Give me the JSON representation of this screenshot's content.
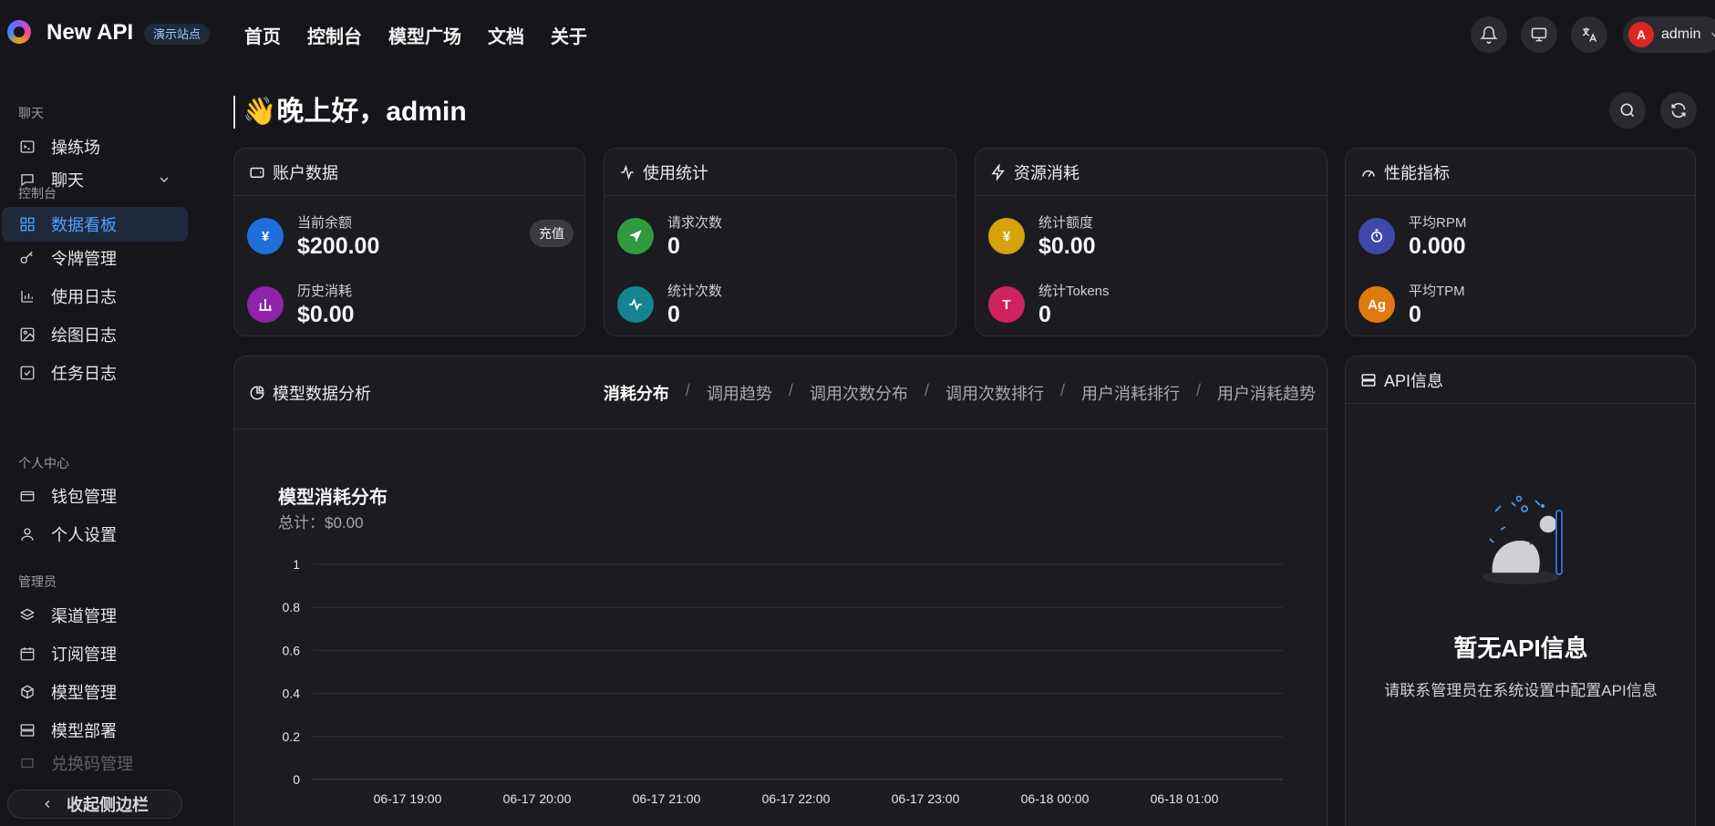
{
  "header": {
    "brand": "New API",
    "badge": "演示站点",
    "nav": [
      "首页",
      "控制台",
      "模型广场",
      "文档",
      "关于"
    ],
    "user": {
      "initial": "A",
      "name": "admin"
    },
    "icons": [
      "bell-icon",
      "monitor-icon",
      "translate-icon",
      "chevron-down-icon"
    ]
  },
  "sidebar": {
    "groups": [
      "聊天",
      "控制台",
      "个人中心",
      "管理员"
    ],
    "chat_items": [
      "操练场",
      "聊天"
    ],
    "console_items": [
      "数据看板",
      "令牌管理",
      "使用日志",
      "绘图日志",
      "任务日志"
    ],
    "personal_items": [
      "钱包管理",
      "个人设置"
    ],
    "admin_items": [
      "渠道管理",
      "订阅管理",
      "模型管理",
      "模型部署",
      "兑换码管理"
    ],
    "collapse_label": "收起侧边栏"
  },
  "greeting": "👋晚上好，admin",
  "cards": {
    "account": {
      "title": "账户数据",
      "balance_label": "当前余额",
      "balance_value": "$200.00",
      "recharge_label": "充值",
      "history_label": "历史消耗",
      "history_value": "$0.00"
    },
    "usage": {
      "title": "使用统计",
      "requests_label": "请求次数",
      "requests_value": "0",
      "stat_count_label": "统计次数",
      "stat_count_value": "0"
    },
    "resource": {
      "title": "资源消耗",
      "quota_label": "统计额度",
      "quota_value": "$0.00",
      "tokens_label": "统计Tokens",
      "tokens_value": "0"
    },
    "perf": {
      "title": "性能指标",
      "rpm_label": "平均RPM",
      "rpm_value": "0.000",
      "tpm_label": "平均TPM",
      "tpm_value": "0"
    }
  },
  "analysis": {
    "title": "模型数据分析",
    "tabs": [
      "消耗分布",
      "调用趋势",
      "调用次数分布",
      "调用次数排行",
      "用户消耗排行",
      "用户消耗趋势"
    ],
    "active_tab": "消耗分布",
    "chart_title": "模型消耗分布",
    "chart_subtitle": "总计：$0.00"
  },
  "api_info": {
    "title": "API信息",
    "empty_title": "暂无API信息",
    "empty_desc": "请联系管理员在系统设置中配置API信息"
  },
  "colors": {
    "accent": "#4ea1ff",
    "balance": "#1e6fd9",
    "history": "#8e24aa",
    "requests": "#2e9b3e",
    "stat_count": "#14848f",
    "quota": "#d4a20a",
    "tokens": "#d0225e",
    "rpm": "#3f4aa8",
    "tpm": "#e07a10"
  },
  "chart_data": {
    "type": "bar",
    "categories": [
      "06-17 19:00",
      "06-17 20:00",
      "06-17 21:00",
      "06-17 22:00",
      "06-17 23:00",
      "06-18 00:00",
      "06-18 01:00"
    ],
    "values": [
      0,
      0,
      0,
      0,
      0,
      0,
      0
    ],
    "yticks": [
      "0",
      "0.2",
      "0.4",
      "0.6",
      "0.8",
      "1"
    ],
    "ylim": [
      0,
      1
    ],
    "grid": true
  }
}
